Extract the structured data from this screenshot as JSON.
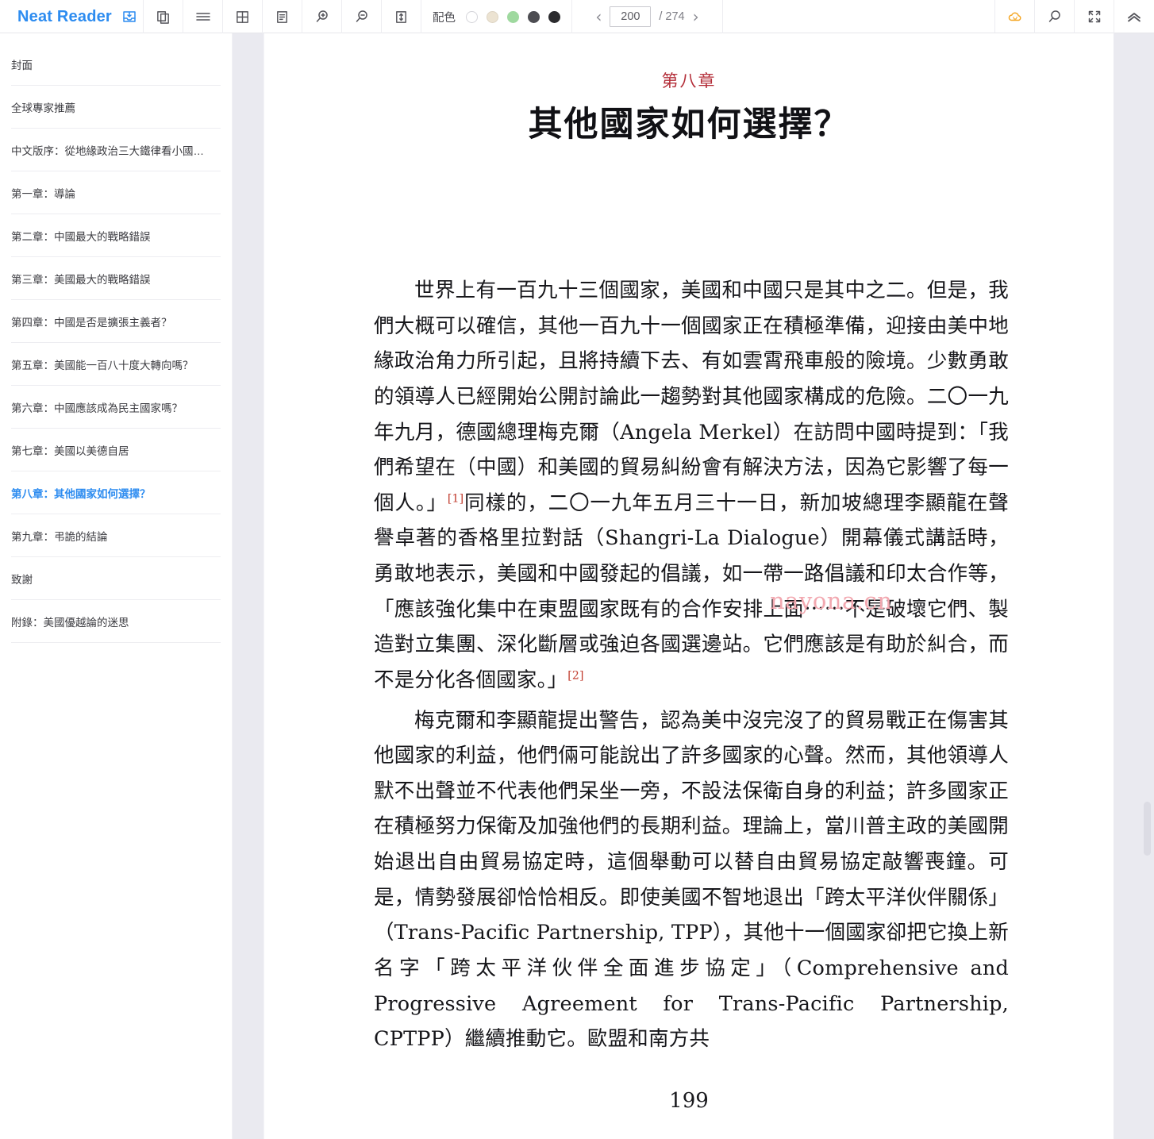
{
  "app": {
    "brand": "Neat Reader",
    "brand_color": "#2d8cf0"
  },
  "toolbar": {
    "icons": [
      {
        "name": "save-library-icon",
        "label": "save-to-library"
      },
      {
        "name": "two-page-icon",
        "label": "page-layout"
      },
      {
        "name": "menu-icon",
        "label": "contents-menu"
      },
      {
        "name": "grid-icon",
        "label": "grid-view"
      },
      {
        "name": "note-icon",
        "label": "notes"
      },
      {
        "name": "zoom-in-icon",
        "label": "zoom-in"
      },
      {
        "name": "zoom-out-icon",
        "label": "zoom-out"
      },
      {
        "name": "line-height-icon",
        "label": "line-spacing"
      }
    ],
    "color_scheme": {
      "label": "配色",
      "swatches": [
        {
          "name": "white",
          "color": "#ffffff",
          "border": "#d5d5da",
          "selected": false
        },
        {
          "name": "sepia",
          "color": "#ece3d2",
          "border": "#ddd4c3",
          "selected": false
        },
        {
          "name": "green",
          "color": "#9fd99f",
          "border": "#9fd99f",
          "selected": false
        },
        {
          "name": "dark-gray",
          "color": "#4d4d52",
          "border": "#4d4d52",
          "selected": false
        },
        {
          "name": "black",
          "color": "#2b2b2e",
          "border": "#2b2b2e",
          "selected": false
        }
      ]
    },
    "pager": {
      "prev": "‹",
      "next": "›",
      "current_page": "200",
      "total_label": "/ 274",
      "placeholder": "200"
    },
    "right_icons": [
      {
        "name": "cloud-sync-icon",
        "label": "cloud-sync",
        "color": "#f5a623"
      },
      {
        "name": "search-icon",
        "label": "search"
      },
      {
        "name": "fullscreen-icon",
        "label": "fullscreen"
      },
      {
        "name": "collapse-up-icon",
        "label": "collapse-toolbar"
      }
    ]
  },
  "sidebar": {
    "items": [
      {
        "label": "封面",
        "active": false
      },
      {
        "label": "全球專家推薦",
        "active": false
      },
      {
        "label": "中文版序：從地緣政治三大鐵律看小國…",
        "active": false
      },
      {
        "label": "第一章：導論",
        "active": false
      },
      {
        "label": "第二章：中國最大的戰略錯誤",
        "active": false
      },
      {
        "label": "第三章：美國最大的戰略錯誤",
        "active": false
      },
      {
        "label": "第四章：中國是否是擴張主義者？",
        "active": false
      },
      {
        "label": "第五章：美國能一百八十度大轉向嗎？",
        "active": false
      },
      {
        "label": "第六章：中國應該成為民主國家嗎？",
        "active": false
      },
      {
        "label": "第七章：美國以美德自居",
        "active": false
      },
      {
        "label": "第八章：其他國家如何選擇？",
        "active": true
      },
      {
        "label": "第九章：弔詭的結論",
        "active": false
      },
      {
        "label": "致謝",
        "active": false
      },
      {
        "label": "附錄：美國優越論的迷思",
        "active": false
      }
    ]
  },
  "content": {
    "chapter_label": "第八章",
    "chapter_title": "其他國家如何選擇？",
    "paragraph_1_a": "世界上有一百九十三個國家，美國和中國只是其中之二。但是，我們大概可以確信，其他一百九十一個國家正在積極準備，迎接由美中地緣政治角力所引起，且將持續下去、有如雲霄飛車般的險境。少數勇敢的領導人已經開始公開討論此一趨勢對其他國家構成的危險。二〇一九年九月，德國總理梅克爾（Angela Merkel）在訪問中國時提到：「我們希望在（中國）和美國的貿易糾紛會有解決方法，因為它影響了每一個人。」",
    "footnote_1": "[1]",
    "paragraph_1_b": "同樣的，二〇一九年五月三十一日，新加坡總理李顯龍在聲譽卓著的香格里拉對話（Shangri-La Dialogue）開幕儀式講話時，勇敢地表示，美國和中國發起的倡議，如一帶一路倡議和印太合作等，「應該強化集中在東盟國家既有的合作安排上面⋯⋯不是破壞它們、製造對立集團、深化斷層或強迫各國選邊站。它們應該是有助於糾合，而不是分化各個國家。」",
    "footnote_2": "[2]",
    "paragraph_2": "梅克爾和李顯龍提出警告，認為美中沒完沒了的貿易戰正在傷害其他國家的利益，他們倆可能說出了許多國家的心聲。然而，其他領導人默不出聲並不代表他們呆坐一旁，不設法保衛自身的利益；許多國家正在積極努力保衛及加強他們的長期利益。理論上，當川普主政的美國開始退出自由貿易協定時，這個舉動可以替自由貿易協定敲響喪鐘。可是，情勢發展卻恰恰相反。即使美國不智地退出「跨太平洋伙伴關係」（Trans-Pacific Partnership, TPP），其他十一個國家卻把它換上新名字「跨太平洋伙伴全面進步協定」（Comprehensive and Progressive Agreement for Trans-Pacific Partnership, CPTPP）繼續推動它。歐盟和南方共",
    "watermark": "nayona.cn",
    "page_number": "199"
  }
}
